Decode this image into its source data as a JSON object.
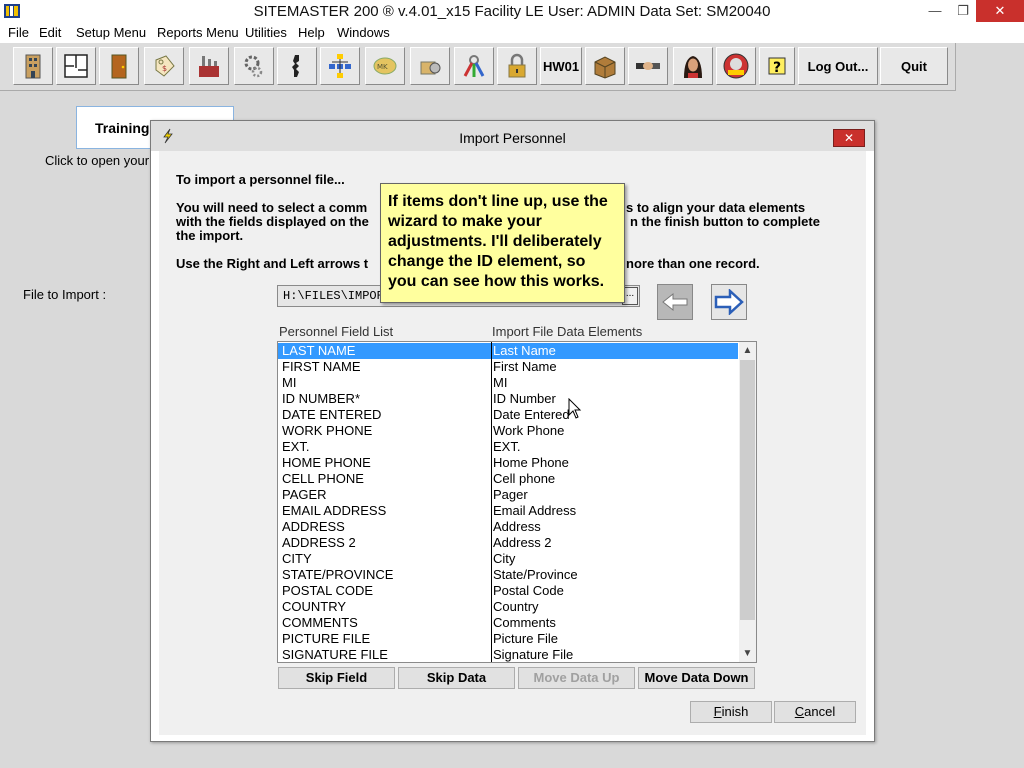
{
  "window": {
    "title": "SITEMASTER 200 ® v.4.01_x15 Facility LE    User: ADMIN    Data Set: SM20040",
    "min_glyph": "—",
    "max_glyph": "❐",
    "close_glyph": "✕"
  },
  "menu": [
    "File",
    "Edit",
    "Setup Menu",
    "Reports Menu",
    "Utilities",
    "Help",
    "Windows"
  ],
  "toolbar": {
    "icons": [
      "building-icon",
      "floorplan-icon",
      "door-icon",
      "key-tag-icon",
      "factory-icon",
      "gears-icon",
      "key-cut-icon",
      "hierarchy-icon",
      "master-key-icon",
      "lock-cylinder-icon",
      "key-ring-icon",
      "padlock-icon"
    ],
    "hw_label": "HW01",
    "icons2": [
      "box-icon",
      "handshake-icon",
      "person-icon",
      "safety-badge-icon",
      "help-icon"
    ],
    "logout_label": "Log Out...",
    "quit_label": "Quit"
  },
  "background": {
    "tab_label": "Training",
    "hint": "Click to open your"
  },
  "dialog": {
    "title": "Import Personnel",
    "close_glyph": "✕",
    "line1": "To import a personnel file...",
    "line2": "You will need to select a comm",
    "line2b": "s to align your data elements",
    "line3": "with the fields displayed on the",
    "line3b": "n the finish button to complete",
    "line4": "the import.",
    "line5": "Use the Right and Left arrows t",
    "line5b": "nore than one record.",
    "file_label": "File to Import :",
    "file_value": "H:\\FILES\\IMPOR",
    "browse_glyph": "...",
    "col1_header": "Personnel Field List",
    "col2_header": "Import File Data Elements",
    "rows": [
      {
        "field": "LAST NAME",
        "element": "Last Name"
      },
      {
        "field": "FIRST NAME",
        "element": "First Name"
      },
      {
        "field": "MI",
        "element": "MI"
      },
      {
        "field": "ID NUMBER*",
        "element": "ID Number"
      },
      {
        "field": "DATE ENTERED",
        "element": "Date Entered"
      },
      {
        "field": "WORK PHONE",
        "element": "Work Phone"
      },
      {
        "field": "EXT.",
        "element": "EXT."
      },
      {
        "field": "HOME PHONE",
        "element": "Home Phone"
      },
      {
        "field": "CELL PHONE",
        "element": "Cell phone"
      },
      {
        "field": "PAGER",
        "element": "Pager"
      },
      {
        "field": "EMAIL ADDRESS",
        "element": "Email Address"
      },
      {
        "field": "ADDRESS",
        "element": "Address"
      },
      {
        "field": "ADDRESS 2",
        "element": "Address 2"
      },
      {
        "field": "CITY",
        "element": "City"
      },
      {
        "field": "STATE/PROVINCE",
        "element": "State/Province"
      },
      {
        "field": "POSTAL CODE",
        "element": "Postal Code"
      },
      {
        "field": "COUNTRY",
        "element": "Country"
      },
      {
        "field": "COMMENTS",
        "element": "Comments"
      },
      {
        "field": "PICTURE FILE",
        "element": "Picture File"
      },
      {
        "field": "SIGNATURE FILE",
        "element": "Signature File"
      }
    ],
    "selected_row": 0,
    "buttons": {
      "skip_field": "Skip Field",
      "skip_data": "Skip Data",
      "move_up": "Move Data Up",
      "move_down": "Move Data Down",
      "finish": "Finish",
      "cancel": "Cancel"
    }
  },
  "tooltip": {
    "text": "If items don't line up, use the wizard to make your adjustments. I'll deliberately change the ID element, so you can see how this works."
  },
  "colors": {
    "selection": "#3399ff",
    "tooltip_bg": "#ffff9e",
    "close_red": "#c9302c"
  }
}
